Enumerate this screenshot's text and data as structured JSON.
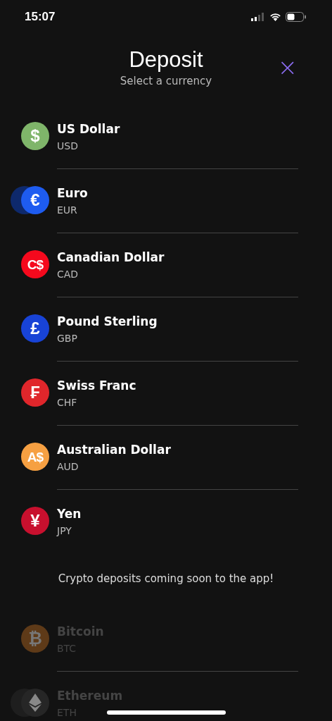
{
  "status_bar": {
    "time": "15:07"
  },
  "header": {
    "title": "Deposit",
    "subtitle": "Select a currency",
    "close": "×"
  },
  "currencies": [
    {
      "name": "US Dollar",
      "code": "USD",
      "symbol": "$",
      "color": "#7fb56a",
      "stacked": false,
      "disabled": false
    },
    {
      "name": "Euro",
      "code": "EUR",
      "symbol": "€",
      "color": "#1e5cf0",
      "stacked": true,
      "disabled": false
    },
    {
      "name": "Canadian Dollar",
      "code": "CAD",
      "symbol": "C$",
      "color": "#f5091d",
      "stacked": false,
      "disabled": false
    },
    {
      "name": "Pound Sterling",
      "code": "GBP",
      "symbol": "£",
      "color": "#1843d6",
      "stacked": false,
      "disabled": false
    },
    {
      "name": "Swiss Franc",
      "code": "CHF",
      "symbol": "₣",
      "color": "#e0262b",
      "stacked": false,
      "disabled": false
    },
    {
      "name": "Australian Dollar",
      "code": "AUD",
      "symbol": "A$",
      "color": "#f6a042",
      "stacked": false,
      "disabled": false
    },
    {
      "name": "Yen",
      "code": "JPY",
      "symbol": "¥",
      "color": "#c8102e",
      "stacked": false,
      "disabled": false
    }
  ],
  "notice": "Crypto deposits coming soon to the app!",
  "crypto": [
    {
      "name": "Bitcoin",
      "code": "BTC",
      "symbol": "₿",
      "color": "#5e3a18",
      "stacked": false,
      "disabled": true
    },
    {
      "name": "Ethereum",
      "code": "ETH",
      "kind": "diamond",
      "color": "#262626",
      "stacked": true,
      "disabled": true
    }
  ]
}
